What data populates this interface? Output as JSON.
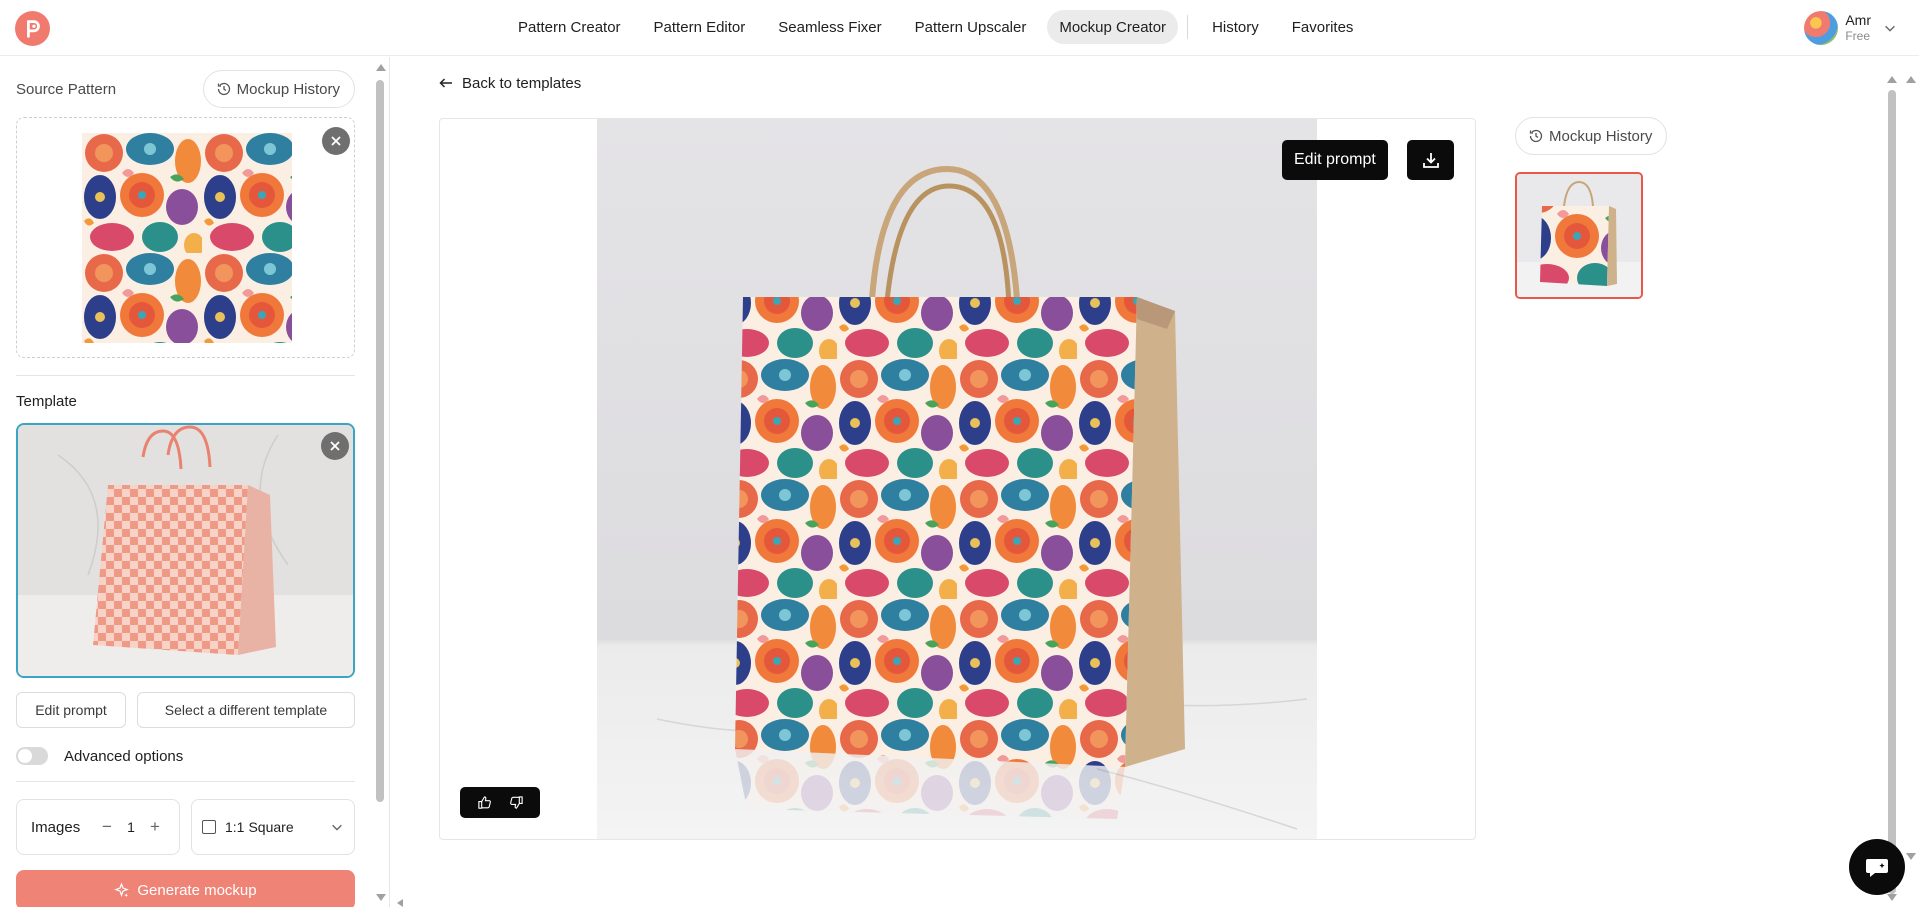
{
  "nav": {
    "items": [
      "Pattern Creator",
      "Pattern Editor",
      "Seamless Fixer",
      "Pattern Upscaler",
      "Mockup Creator",
      "History",
      "Favorites"
    ],
    "active": "Mockup Creator"
  },
  "user": {
    "name": "Amr",
    "plan": "Free"
  },
  "left": {
    "source_label": "Source Pattern",
    "history_button": "Mockup History",
    "template_label": "Template",
    "edit_prompt": "Edit prompt",
    "select_template": "Select a different template",
    "advanced_options": "Advanced options",
    "images_label": "Images",
    "images_count": "1",
    "ratio_value": "1:1",
    "ratio_label": "Square",
    "generate": "Generate mockup"
  },
  "main": {
    "back": "Back to templates",
    "edit_prompt": "Edit prompt",
    "history_button": "Mockup History"
  },
  "colors": {
    "accent": "#ee8376",
    "selected_template_border": "#3ba4c2",
    "selected_thumb_border": "#e8584a",
    "logo": "#f07a6e"
  },
  "icons": [
    "logo-icon",
    "chevron-down-icon",
    "history-icon",
    "close-icon",
    "minus-icon",
    "plus-icon",
    "sparkle-icon",
    "arrow-left-icon",
    "download-icon",
    "thumbs-up-icon",
    "thumbs-down-icon",
    "chat-icon"
  ]
}
